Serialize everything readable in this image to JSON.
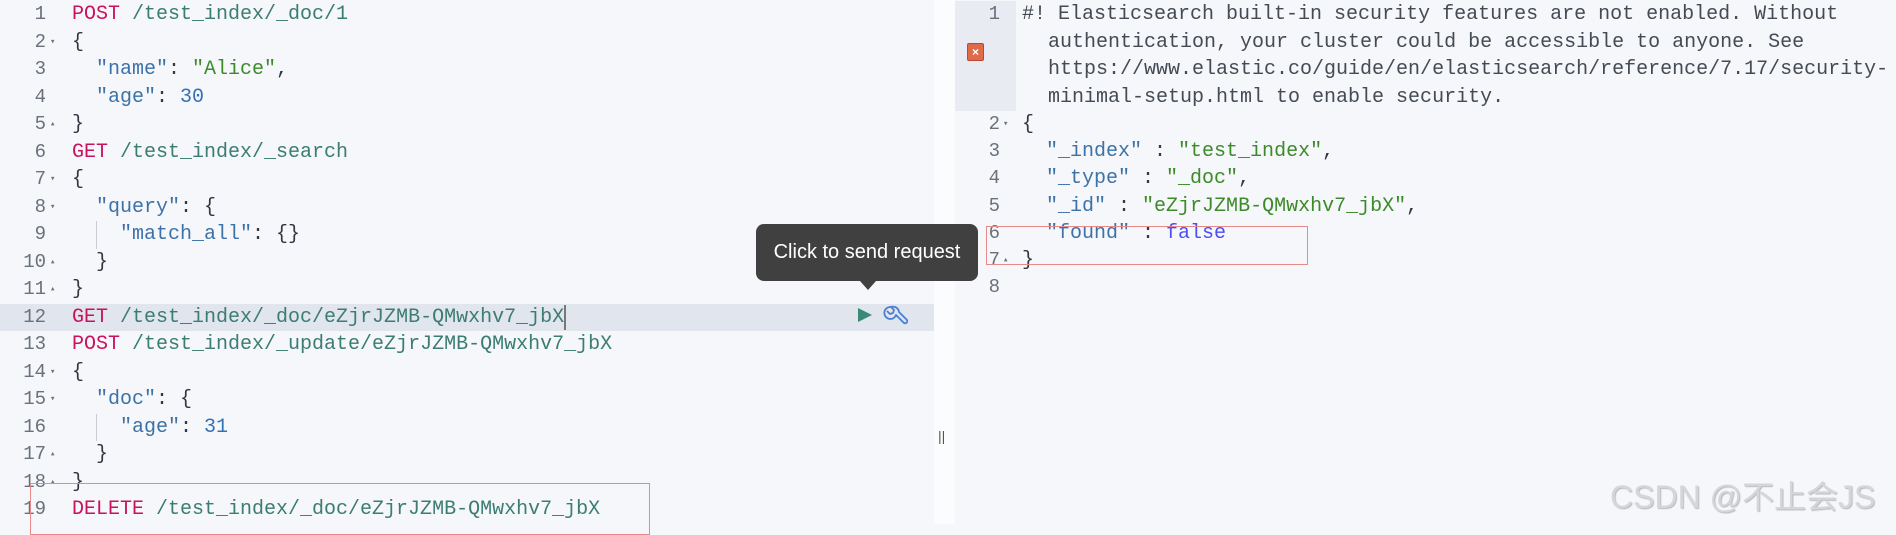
{
  "request_editor": {
    "active_line": 12,
    "lines": [
      {
        "n": "1",
        "fold": "",
        "indent": 0,
        "tokens": [
          [
            "method",
            "POST"
          ],
          [
            "path",
            " /test_index/_doc/1"
          ]
        ]
      },
      {
        "n": "2",
        "fold": "down",
        "indent": 0,
        "tokens": [
          [
            "punc",
            "{"
          ]
        ]
      },
      {
        "n": "3",
        "fold": "",
        "indent": 1,
        "tokens": [
          [
            "key",
            "\"name\""
          ],
          [
            "punc",
            ": "
          ],
          [
            "str",
            "\"Alice\""
          ],
          [
            "punc",
            ","
          ]
        ]
      },
      {
        "n": "4",
        "fold": "",
        "indent": 1,
        "tokens": [
          [
            "key",
            "\"age\""
          ],
          [
            "punc",
            ": "
          ],
          [
            "num",
            "30"
          ]
        ]
      },
      {
        "n": "5",
        "fold": "up",
        "indent": 0,
        "tokens": [
          [
            "punc",
            "}"
          ]
        ]
      },
      {
        "n": "6",
        "fold": "",
        "indent": 0,
        "tokens": [
          [
            "method",
            "GET"
          ],
          [
            "path",
            " /test_index/_search"
          ]
        ]
      },
      {
        "n": "7",
        "fold": "down",
        "indent": 0,
        "tokens": [
          [
            "punc",
            "{"
          ]
        ]
      },
      {
        "n": "8",
        "fold": "down",
        "indent": 1,
        "tokens": [
          [
            "key",
            "\"query\""
          ],
          [
            "punc",
            ": {"
          ]
        ]
      },
      {
        "n": "9",
        "fold": "",
        "indent": 2,
        "guide": true,
        "tokens": [
          [
            "key",
            "\"match_all\""
          ],
          [
            "punc",
            ": {}"
          ]
        ]
      },
      {
        "n": "10",
        "fold": "up",
        "indent": 1,
        "tokens": [
          [
            "punc",
            "}"
          ]
        ]
      },
      {
        "n": "11",
        "fold": "up",
        "indent": 0,
        "tokens": [
          [
            "punc",
            "}"
          ]
        ]
      },
      {
        "n": "12",
        "fold": "",
        "indent": 0,
        "tokens": [
          [
            "method",
            "GET"
          ],
          [
            "path",
            " /test_index/_doc/eZjrJZMB-QMwxhv7_jbX"
          ]
        ]
      },
      {
        "n": "13",
        "fold": "",
        "indent": 0,
        "tokens": [
          [
            "method",
            "POST"
          ],
          [
            "path",
            " /test_index/_update/eZjrJZMB-QMwxhv7_jbX"
          ]
        ]
      },
      {
        "n": "14",
        "fold": "down",
        "indent": 0,
        "tokens": [
          [
            "punc",
            "{"
          ]
        ]
      },
      {
        "n": "15",
        "fold": "down",
        "indent": 1,
        "tokens": [
          [
            "key",
            "\"doc\""
          ],
          [
            "punc",
            ": {"
          ]
        ]
      },
      {
        "n": "16",
        "fold": "",
        "indent": 2,
        "guide": true,
        "tokens": [
          [
            "key",
            "\"age\""
          ],
          [
            "punc",
            ": "
          ],
          [
            "num",
            "31"
          ]
        ]
      },
      {
        "n": "17",
        "fold": "up",
        "indent": 1,
        "tokens": [
          [
            "punc",
            "}"
          ]
        ]
      },
      {
        "n": "18",
        "fold": "up",
        "indent": 0,
        "tokens": [
          [
            "punc",
            "}"
          ]
        ]
      },
      {
        "n": "19",
        "fold": "",
        "indent": 0,
        "tokens": [
          [
            "method",
            "DELETE"
          ],
          [
            "path",
            " /test_index/_doc/eZjrJZMB-QMwxhv7_jbX"
          ]
        ]
      }
    ],
    "tooltip": "Click to send request",
    "actions": {
      "send": "play-icon",
      "copy_as_curl": "wrench-icon"
    }
  },
  "response_viewer": {
    "warning_line_number": "1",
    "warning": "#! Elasticsearch built-in security features are not enabled. Without authentication, your cluster could be accessible to anyone. See https://www.elastic.co/guide/en/elasticsearch/reference/7.17/security-minimal-setup.html to enable security.",
    "warning_icon": "error-x-icon",
    "lines": [
      {
        "n": "2",
        "fold": "down",
        "indent": 0,
        "tokens": [
          [
            "punc",
            "{"
          ]
        ]
      },
      {
        "n": "3",
        "fold": "",
        "indent": 1,
        "tokens": [
          [
            "key",
            "\"_index\""
          ],
          [
            "punc",
            " : "
          ],
          [
            "str",
            "\"test_index\""
          ],
          [
            "punc",
            ","
          ]
        ]
      },
      {
        "n": "4",
        "fold": "",
        "indent": 1,
        "tokens": [
          [
            "key",
            "\"_type\""
          ],
          [
            "punc",
            " : "
          ],
          [
            "str",
            "\"_doc\""
          ],
          [
            "punc",
            ","
          ]
        ]
      },
      {
        "n": "5",
        "fold": "",
        "indent": 1,
        "tokens": [
          [
            "key",
            "\"_id\""
          ],
          [
            "punc",
            " : "
          ],
          [
            "str",
            "\"eZjrJZMB-QMwxhv7_jbX\""
          ],
          [
            "punc",
            ","
          ]
        ]
      },
      {
        "n": "6",
        "fold": "",
        "indent": 1,
        "tokens": [
          [
            "key",
            "\"found\""
          ],
          [
            "punc",
            " : "
          ],
          [
            "bool",
            "false"
          ]
        ]
      },
      {
        "n": "7",
        "fold": "up",
        "indent": 0,
        "tokens": [
          [
            "punc",
            "}"
          ]
        ]
      },
      {
        "n": "8",
        "fold": "",
        "indent": 0,
        "tokens": []
      }
    ]
  },
  "divider_handle": "||",
  "watermark": "CSDN @不止会JS",
  "colors": {
    "method": "#c8125f",
    "path": "#3b7d72",
    "key": "#3d72a8",
    "string": "#3d8a2a",
    "number": "#3373b5",
    "boolean": "#4d4df5",
    "highlight_box": "#e78a8a",
    "tooltip_bg": "#404040"
  }
}
